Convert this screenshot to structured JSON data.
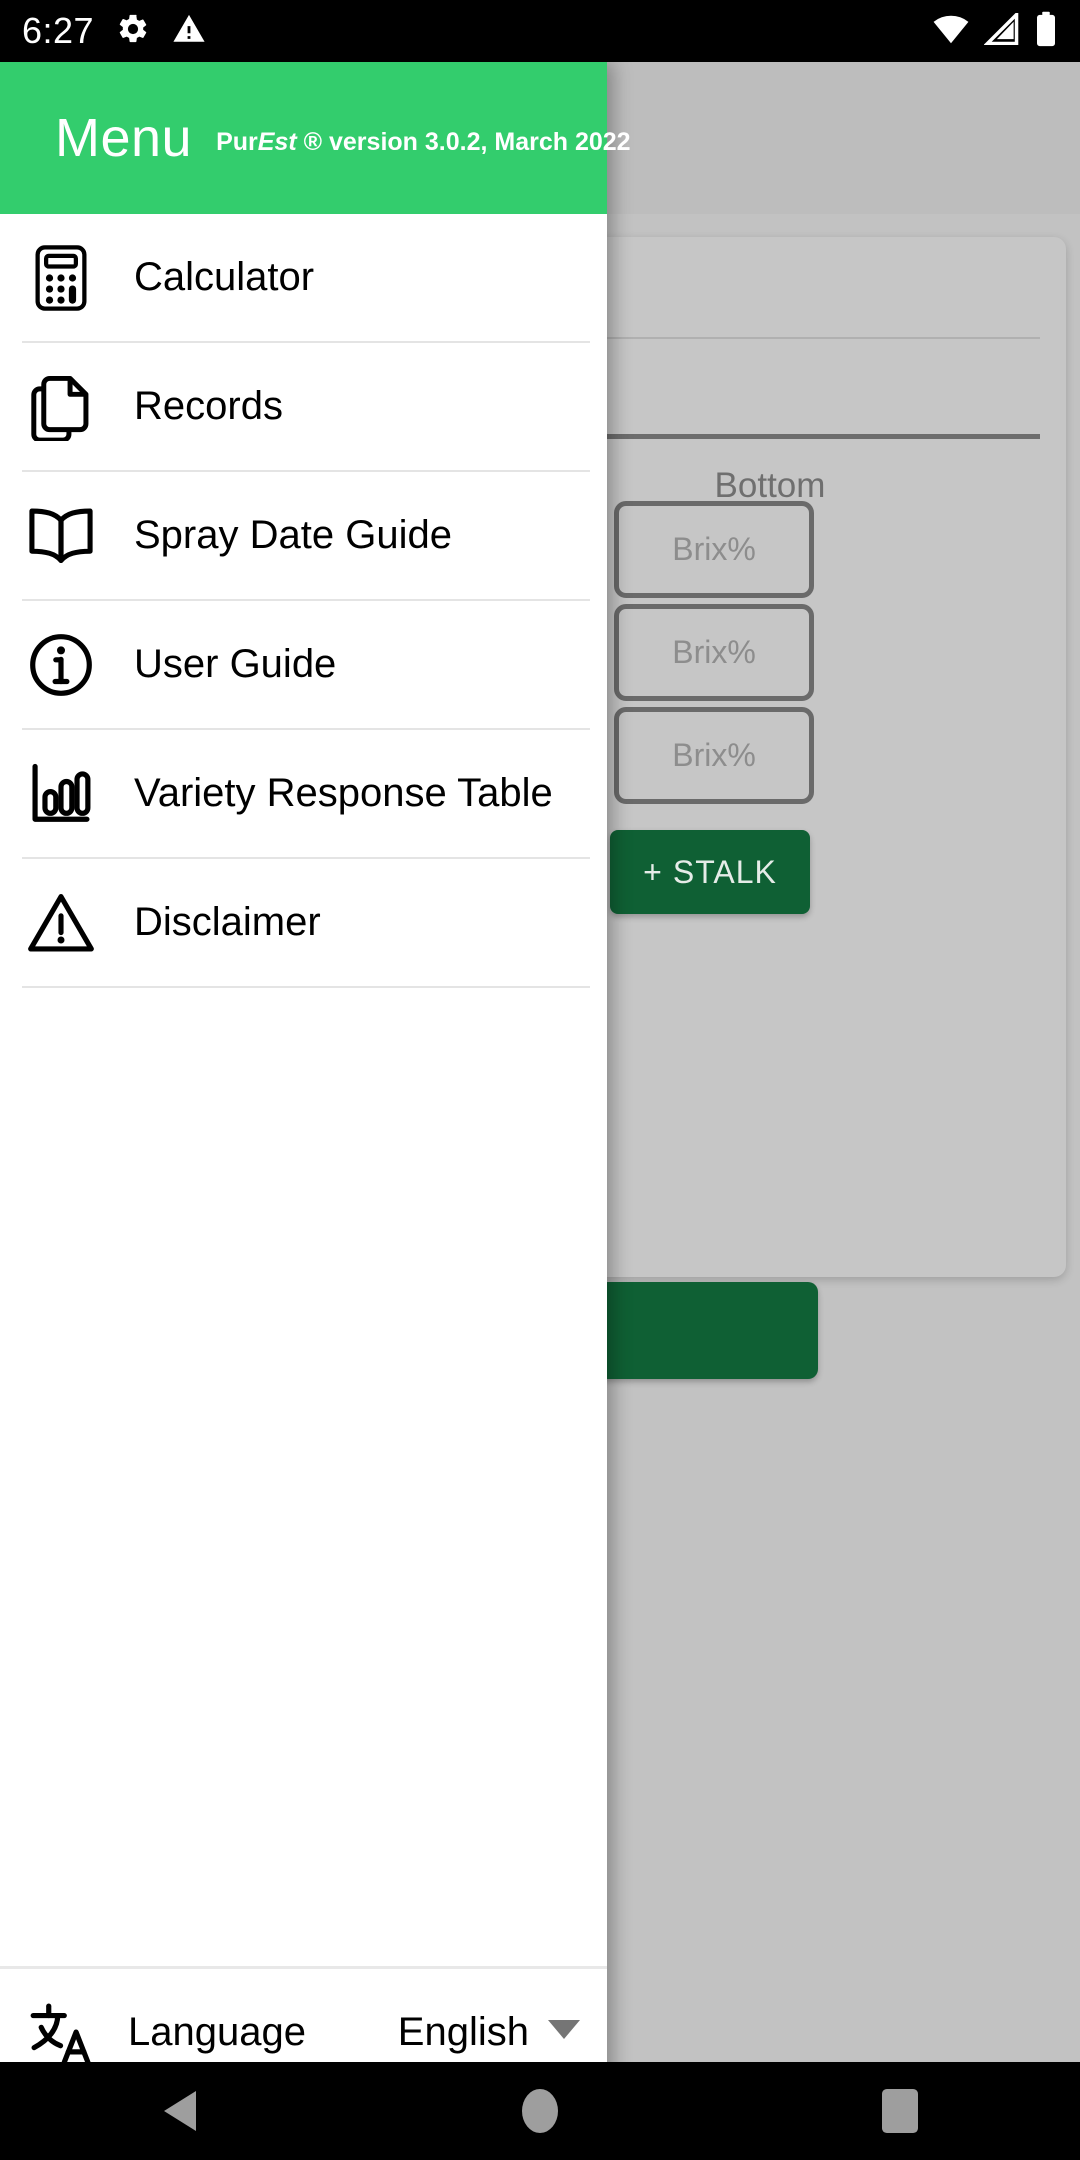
{
  "status_bar": {
    "time": "6:27",
    "left_icons": [
      "gear-icon",
      "warning-triangle-icon"
    ],
    "right_icons": [
      "wifi-icon",
      "cell-signal-icon",
      "battery-icon"
    ]
  },
  "drawer": {
    "header": {
      "title": "Menu",
      "subtitle_parts": {
        "pre": "Pur",
        "italic": "Est",
        "post": " ® version 3.0.2, March 2022"
      },
      "subtitle_full": "PurEst ® version 3.0.2, March 2022",
      "bg_color": "#33cd6d"
    },
    "items": [
      {
        "label": "Calculator",
        "icon": "calculator-icon"
      },
      {
        "label": "Records",
        "icon": "documents-icon"
      },
      {
        "label": "Spray Date Guide",
        "icon": "open-book-icon"
      },
      {
        "label": "User Guide",
        "icon": "info-circle-icon"
      },
      {
        "label": "Variety Response Table",
        "icon": "bar-chart-icon"
      },
      {
        "label": "Disclaimer",
        "icon": "warning-triangle-icon"
      }
    ],
    "language": {
      "label": "Language",
      "value": "English",
      "icon": "translate-icon",
      "caret": "chevron-down-icon"
    }
  },
  "background_app": {
    "section_label": "Bottom",
    "brix_placeholder_1": "Brix%",
    "brix_placeholder_2": "Brix%",
    "brix_placeholder_3": "Brix%",
    "add_stalk_button": "STALK",
    "add_stalk_prefix": "+",
    "accent_green": "#0f6034",
    "scrim_color": "#c2c2c2"
  },
  "nav_bar": {
    "back": "back-triangle-icon",
    "home": "home-circle-icon",
    "recents": "recents-square-icon"
  }
}
